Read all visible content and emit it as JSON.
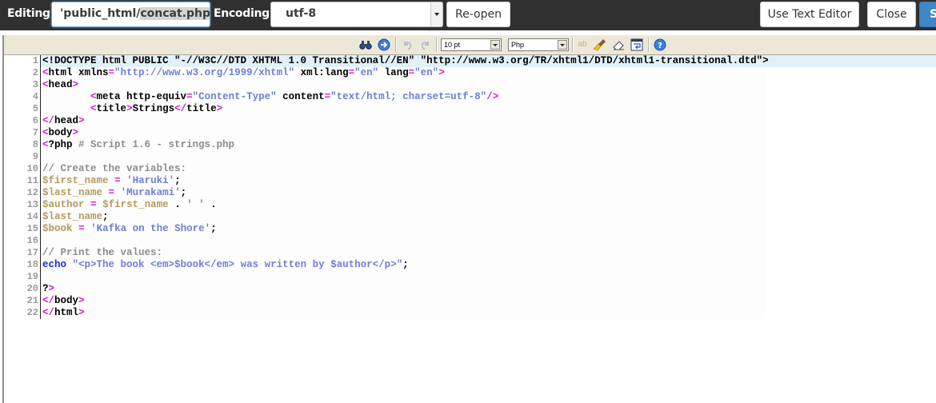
{
  "topbar": {
    "editing_label": "Editing:",
    "editing_path_prefix": "'public_html/",
    "editing_path_selected": "concat.php",
    "encoding_label": "Encoding:",
    "encoding_value": "utf-8",
    "reopen_label": "Re-open",
    "use_text_editor_label": "Use Text Editor",
    "close_label": "Close",
    "save_label": "S",
    "save_color": "#3f87c9"
  },
  "toolbar": {
    "font_size": "10 pt",
    "syntax": "Php",
    "icons": [
      "search-icon",
      "go-to-line-icon",
      "undo-icon",
      "redo-icon",
      "spell-check-icon",
      "highlight-toggle-icon",
      "reset-highlight-icon",
      "word-wrap-icon",
      "help-icon"
    ]
  },
  "editor": {
    "current_line": 1,
    "lines": [
      {
        "n": "1",
        "tokens": [
          {
            "c": "t-doctype",
            "t": "<!DOCTYPE html PUBLIC \"-//W3C//DTD XHTML 1.0 Transitional//EN\" \"http://www.w3.org/TR/xhtml1/DTD/xhtml1-transitional.dtd\">"
          }
        ]
      },
      {
        "n": "2",
        "tokens": [
          {
            "c": "t-tag",
            "t": "<"
          },
          {
            "c": "t-attr",
            "t": "html xmlns"
          },
          {
            "c": "t-tag",
            "t": "="
          },
          {
            "c": "t-str",
            "t": "\"http://www.w3.org/1999/xhtml\""
          },
          {
            "c": "t-attr",
            "t": " xml:lang"
          },
          {
            "c": "t-tag",
            "t": "="
          },
          {
            "c": "t-str",
            "t": "\"en\""
          },
          {
            "c": "t-attr",
            "t": " lang"
          },
          {
            "c": "t-tag",
            "t": "="
          },
          {
            "c": "t-str",
            "t": "\"en\""
          },
          {
            "c": "t-tag",
            "t": ">"
          }
        ]
      },
      {
        "n": "3",
        "tokens": [
          {
            "c": "t-tag",
            "t": "<"
          },
          {
            "c": "t-attr",
            "t": "head"
          },
          {
            "c": "t-tag",
            "t": ">"
          }
        ]
      },
      {
        "n": "4",
        "tokens": [
          {
            "c": "t-plain",
            "t": "        "
          },
          {
            "c": "t-tag",
            "t": "<"
          },
          {
            "c": "t-attr",
            "t": "meta http-equiv"
          },
          {
            "c": "t-tag",
            "t": "="
          },
          {
            "c": "t-str",
            "t": "\"Content-Type\""
          },
          {
            "c": "t-attr",
            "t": " content"
          },
          {
            "c": "t-tag",
            "t": "="
          },
          {
            "c": "t-str",
            "t": "\"text/html; charset=utf-8\""
          },
          {
            "c": "t-tag",
            "t": "/>"
          }
        ]
      },
      {
        "n": "5",
        "tokens": [
          {
            "c": "t-plain",
            "t": "        "
          },
          {
            "c": "t-tag",
            "t": "<"
          },
          {
            "c": "t-attr",
            "t": "title"
          },
          {
            "c": "t-tag",
            "t": ">"
          },
          {
            "c": "t-plain",
            "t": "Strings"
          },
          {
            "c": "t-tag",
            "t": "</"
          },
          {
            "c": "t-attr",
            "t": "title"
          },
          {
            "c": "t-tag",
            "t": ">"
          }
        ]
      },
      {
        "n": "6",
        "tokens": [
          {
            "c": "t-tag",
            "t": "</"
          },
          {
            "c": "t-attr",
            "t": "head"
          },
          {
            "c": "t-tag",
            "t": ">"
          }
        ]
      },
      {
        "n": "7",
        "tokens": [
          {
            "c": "t-tag",
            "t": "<"
          },
          {
            "c": "t-attr",
            "t": "body"
          },
          {
            "c": "t-tag",
            "t": ">"
          }
        ]
      },
      {
        "n": "8",
        "tokens": [
          {
            "c": "t-tag",
            "t": "<"
          },
          {
            "c": "t-plain",
            "t": "?php "
          },
          {
            "c": "t-com",
            "t": "# Script 1.6 - strings.php"
          }
        ]
      },
      {
        "n": "9",
        "tokens": []
      },
      {
        "n": "10",
        "tokens": [
          {
            "c": "t-com",
            "t": "// Create the variables:"
          }
        ]
      },
      {
        "n": "11",
        "tokens": [
          {
            "c": "t-var",
            "t": "$first_name"
          },
          {
            "c": "t-plain",
            "t": " "
          },
          {
            "c": "t-op",
            "t": "="
          },
          {
            "c": "t-plain",
            "t": " "
          },
          {
            "c": "t-str",
            "t": "'Haruki'"
          },
          {
            "c": "t-plain",
            "t": ";"
          }
        ]
      },
      {
        "n": "12",
        "tokens": [
          {
            "c": "t-var",
            "t": "$last_name"
          },
          {
            "c": "t-plain",
            "t": " "
          },
          {
            "c": "t-op",
            "t": "="
          },
          {
            "c": "t-plain",
            "t": " "
          },
          {
            "c": "t-str",
            "t": "'Murakami'"
          },
          {
            "c": "t-plain",
            "t": ";"
          }
        ]
      },
      {
        "n": "13",
        "tokens": [
          {
            "c": "t-var",
            "t": "$author"
          },
          {
            "c": "t-plain",
            "t": " "
          },
          {
            "c": "t-op",
            "t": "="
          },
          {
            "c": "t-plain",
            "t": " "
          },
          {
            "c": "t-var",
            "t": "$first_name"
          },
          {
            "c": "t-plain",
            "t": " . "
          },
          {
            "c": "t-str",
            "t": "' '"
          },
          {
            "c": "t-plain",
            "t": " ."
          }
        ]
      },
      {
        "n": "14",
        "tokens": [
          {
            "c": "t-var",
            "t": "$last_name"
          },
          {
            "c": "t-plain",
            "t": ";"
          }
        ]
      },
      {
        "n": "15",
        "tokens": [
          {
            "c": "t-var",
            "t": "$book"
          },
          {
            "c": "t-plain",
            "t": " "
          },
          {
            "c": "t-op",
            "t": "="
          },
          {
            "c": "t-plain",
            "t": " "
          },
          {
            "c": "t-str",
            "t": "'Kafka on the Shore'"
          },
          {
            "c": "t-plain",
            "t": ";"
          }
        ]
      },
      {
        "n": "16",
        "tokens": []
      },
      {
        "n": "17",
        "tokens": [
          {
            "c": "t-com",
            "t": "// Print the values:"
          }
        ]
      },
      {
        "n": "18",
        "tokens": [
          {
            "c": "t-kw",
            "t": "echo"
          },
          {
            "c": "t-plain",
            "t": " "
          },
          {
            "c": "t-dstr",
            "t": "\"<p>The book <em>$book</em> was written by $author</p>\""
          },
          {
            "c": "t-plain",
            "t": ";"
          }
        ]
      },
      {
        "n": "19",
        "tokens": []
      },
      {
        "n": "20",
        "tokens": [
          {
            "c": "t-plain",
            "t": "?"
          },
          {
            "c": "t-tag",
            "t": ">"
          }
        ]
      },
      {
        "n": "21",
        "tokens": [
          {
            "c": "t-tag",
            "t": "</"
          },
          {
            "c": "t-attr",
            "t": "body"
          },
          {
            "c": "t-tag",
            "t": ">"
          }
        ]
      },
      {
        "n": "22",
        "tokens": [
          {
            "c": "t-tag",
            "t": "</"
          },
          {
            "c": "t-attr",
            "t": "html"
          },
          {
            "c": "t-tag",
            "t": ">"
          }
        ]
      }
    ]
  }
}
